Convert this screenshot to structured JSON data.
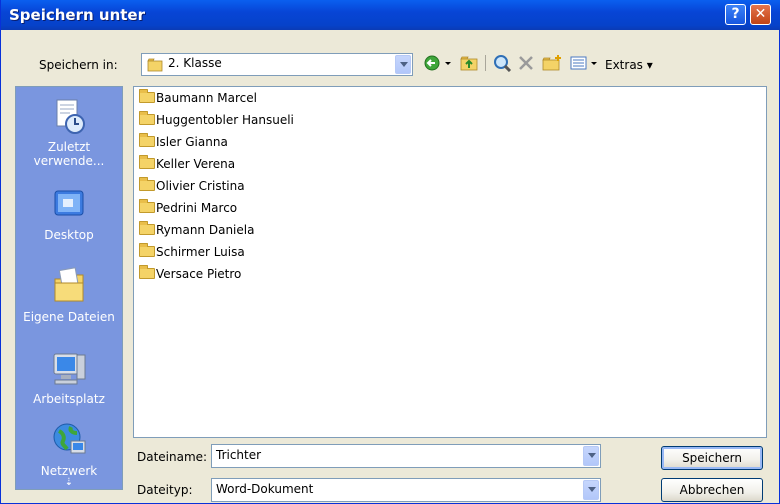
{
  "window": {
    "title": "Speichern unter",
    "help_label": "?",
    "close_label": "✕"
  },
  "save_in": {
    "label": "Speichern in:",
    "folder": "2. Klasse",
    "extras_label": "Extras"
  },
  "places": [
    {
      "label": "Zuletzt verwende...",
      "icon": "recent-documents-icon"
    },
    {
      "label": "Desktop",
      "icon": "desktop-icon"
    },
    {
      "label": "Eigene Dateien",
      "icon": "my-documents-icon"
    },
    {
      "label": "Arbeitsplatz",
      "icon": "my-computer-icon"
    },
    {
      "label": "Netzwerk",
      "icon": "network-icon"
    }
  ],
  "files": [
    {
      "name": "Baumann Marcel"
    },
    {
      "name": "Huggentobler Hansueli"
    },
    {
      "name": "Isler Gianna"
    },
    {
      "name": "Keller Verena"
    },
    {
      "name": "Olivier Cristina"
    },
    {
      "name": "Pedrini Marco"
    },
    {
      "name": "Rymann Daniela"
    },
    {
      "name": "Schirmer Luisa"
    },
    {
      "name": "Versace Pietro"
    }
  ],
  "filename": {
    "label": "Dateiname:",
    "value": "Trichter"
  },
  "filetype": {
    "label": "Dateityp:",
    "value": "Word-Dokument"
  },
  "buttons": {
    "save": "Speichern",
    "cancel": "Abbrechen"
  },
  "colors": {
    "titlebar": "#0A5FEF",
    "places_bar": "#7A96DF",
    "dialog_bg": "#ECE9D8"
  }
}
